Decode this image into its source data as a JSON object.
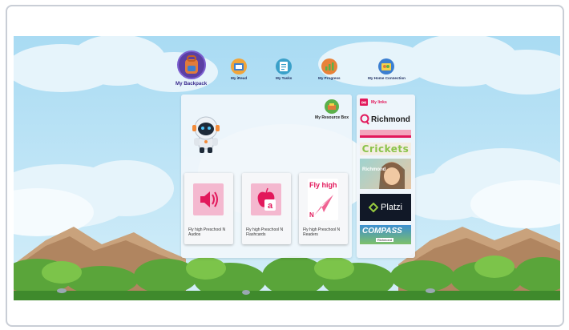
{
  "nav": {
    "items": [
      {
        "label": "My Backpack",
        "active": true,
        "icon": "backpack-icon"
      },
      {
        "label": "My iRead",
        "icon": "iread-icon"
      },
      {
        "label": "My Tasks",
        "icon": "tasks-icon"
      },
      {
        "label": "My Progress",
        "icon": "progress-icon"
      },
      {
        "label": "My Home Connection",
        "icon": "home-connection-icon"
      }
    ]
  },
  "main": {
    "resource_box_label": "My Resource Box",
    "cards": [
      {
        "title": "Fly high Preschool N Audios",
        "icon": "speaker-icon"
      },
      {
        "title": "Fly high Preschool N Flashcards",
        "icon": "apple-letter-icon"
      },
      {
        "title": "Fly high Preschool N Readers",
        "icon": "fly-high-logo",
        "logo_text": "Fly high",
        "logo_letter": "N"
      }
    ]
  },
  "links": {
    "header": "My links",
    "tiles": {
      "richmond": "Richmond",
      "crickets": "Crickets",
      "richmond_photo": "Richmond",
      "platzi": "Platzi",
      "compass": "COMPASS",
      "compass_sub": "Richmond"
    }
  },
  "colors": {
    "accent": "#e2185b",
    "nav_text": "#1d2c5e",
    "active_nav": "#3a2a8e",
    "sky": "#aedcf2"
  }
}
